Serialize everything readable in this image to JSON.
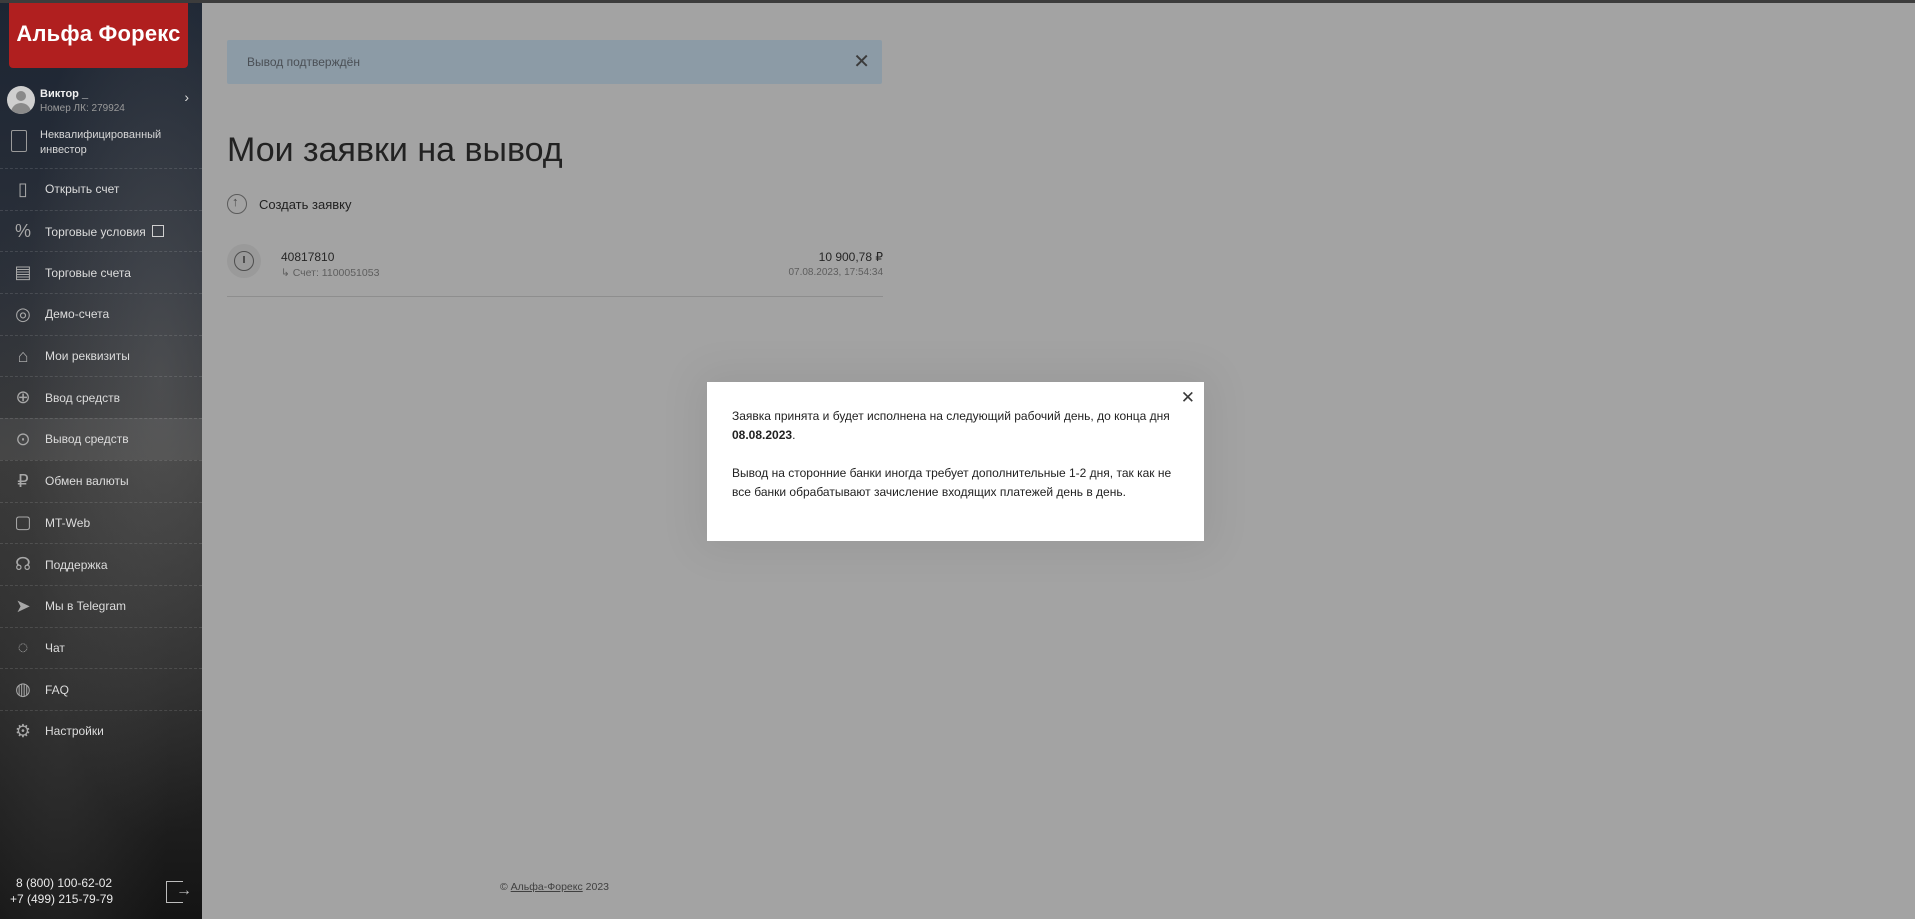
{
  "brand": {
    "logo_text": "Альфа Форекс",
    "accent": "#b01f1f"
  },
  "user": {
    "name": "Виктор _",
    "account_label": "Номер ЛК: 279924"
  },
  "investor_status": "Неквалифицированный инвестор",
  "sidebar": {
    "items": [
      {
        "label": "Открыть счет",
        "icon": "open-account-icon"
      },
      {
        "label": "Торговые условия",
        "icon": "percent-icon"
      },
      {
        "label": "Торговые счета",
        "icon": "trading-accounts-icon"
      },
      {
        "label": "Демо-счета",
        "icon": "gamepad-icon"
      },
      {
        "label": "Мои реквизиты",
        "icon": "bank-icon"
      },
      {
        "label": "Ввод средств",
        "icon": "deposit-icon"
      },
      {
        "label": "Вывод средств",
        "icon": "withdraw-icon"
      },
      {
        "label": "Обмен валюты",
        "icon": "exchange-icon"
      },
      {
        "label": "MT-Web",
        "icon": "mt-web-icon"
      },
      {
        "label": "Поддержка",
        "icon": "headset-icon"
      },
      {
        "label": "Мы в Telegram",
        "icon": "telegram-icon"
      },
      {
        "label": "Чат",
        "icon": "chat-icon"
      },
      {
        "label": "FAQ",
        "icon": "faq-icon"
      },
      {
        "label": "Настройки",
        "icon": "settings-icon"
      }
    ],
    "phones": [
      "8 (800) 100-62-02",
      "+7 (499) 215-79-79"
    ]
  },
  "alert": {
    "text": "Вывод подтверждён"
  },
  "page_title": "Мои заявки на вывод",
  "create_request_label": "Создать заявку",
  "request": {
    "number": "40817810",
    "account": "Счет: 1100051053",
    "amount": "10 900,78 ₽",
    "datetime": "07.08.2023, 17:54:34"
  },
  "footer": {
    "copyright": "©",
    "company": "Альфа-Форекс",
    "year": "2023"
  },
  "modal": {
    "text1": "Заявка принята и будет исполнена на следующий рабочий день, до конца дня",
    "date": "08.08.2023",
    "text2": "Вывод на сторонние банки иногда требует дополнительные 1-2 дня, так как не все банки обрабатывают зачисление входящих платежей день в день."
  }
}
